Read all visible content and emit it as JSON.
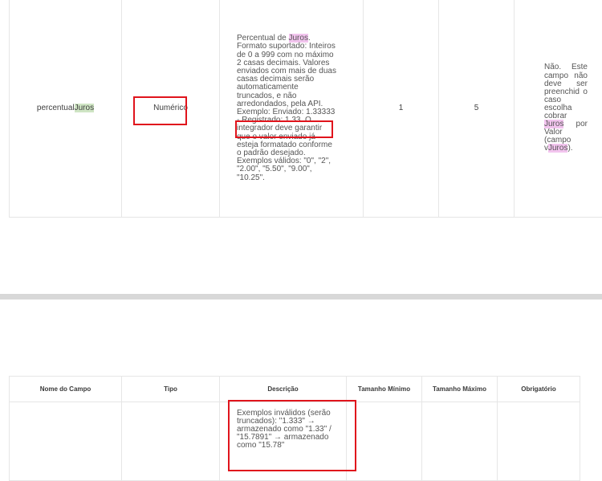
{
  "section1": {
    "row": {
      "field_prefix": "percentual",
      "field_highlight": "Juros",
      "type": "Numérico",
      "desc_prefix": "Percentual de ",
      "desc_highlight": "Juros",
      "desc_rest_a": ". Formato suportado: Inteiros de 0 a 999 com no máximo 2 casas decimais. Valores enviados com mais de duas casas decimais serão automaticamente truncados, e não arredondados, pela API. Exemplo: ",
      "desc_rest_b": "Enviado: 1.33333 - Registrado: 1.33. O integrador deve garantir que o valor enviado já esteja formatado conforme o padrão desejado. Exemplos válidos: \"0\", \"2\", \"2.00\", \"5.50\", \"9.00\", \"10.25\".",
      "min": "1",
      "max": "5",
      "obs_a": "Não. Este campo não deve ser preenchid o caso escolha cobrar ",
      "obs_highlight1": "Juros",
      "obs_b": " por Valor (campo v",
      "obs_highlight2": "Juros",
      "obs_c": ")."
    }
  },
  "section2": {
    "headers": [
      "Nome do Campo",
      "Tipo",
      "Descrição",
      "Tamanho Mínimo",
      "Tamanho Máximo",
      "Obrigatório"
    ],
    "row": {
      "desc": "Exemplos inválidos (serão truncados): \"1.333\" → armazenado como \"1.33\" / \"15.7891\" → armazenado como \"15.78\""
    }
  },
  "colors": {
    "highlight_green": "#cfe5c4",
    "highlight_pink": "#f2c4ee",
    "annotation_red": "#e0141c"
  }
}
